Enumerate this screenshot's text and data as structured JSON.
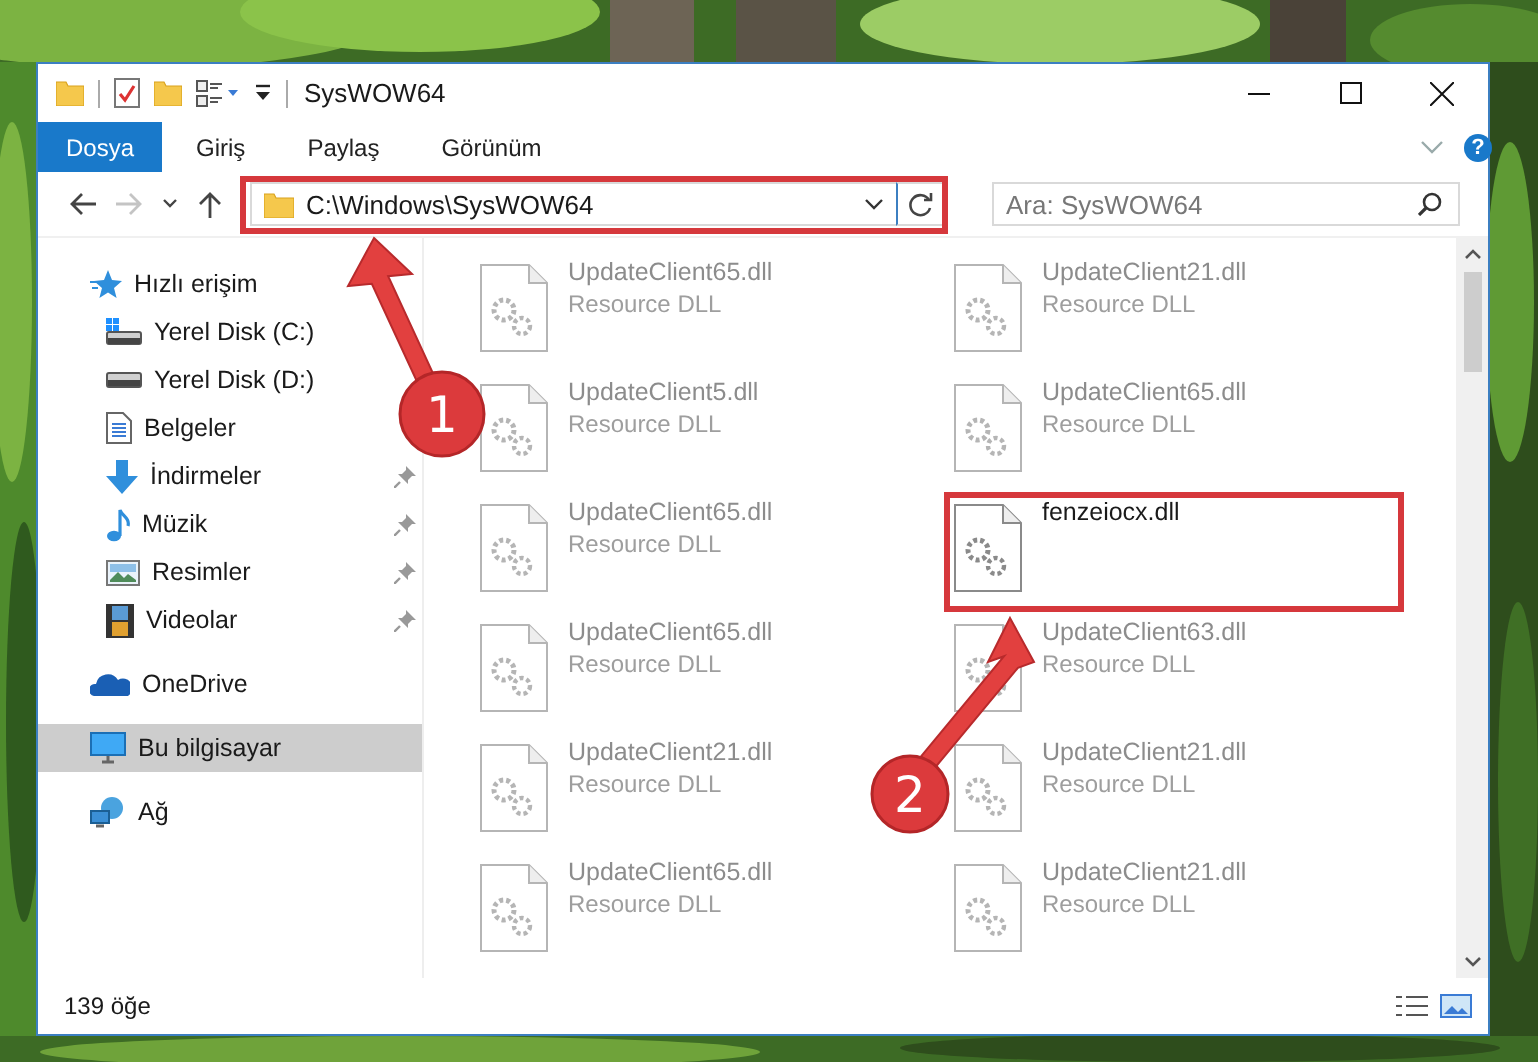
{
  "window": {
    "title": "SysWOW64"
  },
  "ribbon": {
    "tabs": [
      {
        "label": "Dosya",
        "selected": true
      },
      {
        "label": "Giriş",
        "selected": false
      },
      {
        "label": "Paylaş",
        "selected": false
      },
      {
        "label": "Görünüm",
        "selected": false
      }
    ],
    "help": "?"
  },
  "nav_buttons": [
    {
      "kind": "back",
      "disabled": false
    },
    {
      "kind": "forward",
      "disabled": true
    },
    {
      "kind": "recent",
      "disabled": false
    },
    {
      "kind": "up",
      "disabled": false
    }
  ],
  "address": {
    "path": "C:\\Windows\\SysWOW64"
  },
  "search": {
    "placeholder": "Ara: SysWOW64"
  },
  "sidebar": {
    "items": [
      {
        "label": "Hızlı erişim",
        "kind": "star",
        "selected": false,
        "children": [
          {
            "label": "Yerel Disk (C:)",
            "kind": "system-drive",
            "pinned": false
          },
          {
            "label": "Yerel Disk (D:)",
            "kind": "drive",
            "pinned": false
          },
          {
            "label": "Belgeler",
            "kind": "documents",
            "pinned": false
          },
          {
            "label": "İndirmeler",
            "kind": "download",
            "pinned": true
          },
          {
            "label": "Müzik",
            "kind": "music",
            "pinned": true
          },
          {
            "label": "Resimler",
            "kind": "pictures",
            "pinned": true
          },
          {
            "label": "Videolar",
            "kind": "videos",
            "pinned": true
          }
        ]
      },
      {
        "label": "OneDrive",
        "kind": "cloud",
        "selected": false
      },
      {
        "label": "Bu bilgisayar",
        "kind": "computer",
        "selected": true
      },
      {
        "label": "Ağ",
        "kind": "network",
        "selected": false
      }
    ]
  },
  "files": [
    {
      "name": "UpdateClient65.dll",
      "type": "Resource DLL",
      "blurred": true
    },
    {
      "name": "UpdateClient21.dll",
      "type": "Resource DLL",
      "blurred": true
    },
    {
      "name": "UpdateClient5.dll",
      "type": "Resource DLL",
      "blurred": true
    },
    {
      "name": "UpdateClient65.dll",
      "type": "Resource DLL",
      "blurred": true
    },
    {
      "name": "UpdateClient65.dll",
      "type": "Resource DLL",
      "blurred": true
    },
    {
      "name": "fenzeiocx.dll",
      "blurred": false
    },
    {
      "name": "UpdateClient65.dll",
      "type": "Resource DLL",
      "blurred": true
    },
    {
      "name": "UpdateClient63.dll",
      "type": "Resource DLL",
      "blurred": true
    },
    {
      "name": "UpdateClient21.dll",
      "type": "Resource DLL",
      "blurred": true
    },
    {
      "name": "UpdateClient21.dll",
      "type": "Resource DLL",
      "blurred": true
    },
    {
      "name": "UpdateClient65.dll",
      "type": "Resource DLL",
      "blurred": true
    },
    {
      "name": "UpdateClient21.dll",
      "type": "Resource DLL",
      "blurred": true
    }
  ],
  "status_bar": {
    "count": "139 öğe"
  },
  "annotations": [
    {
      "number": "1"
    },
    {
      "number": "2"
    }
  ]
}
